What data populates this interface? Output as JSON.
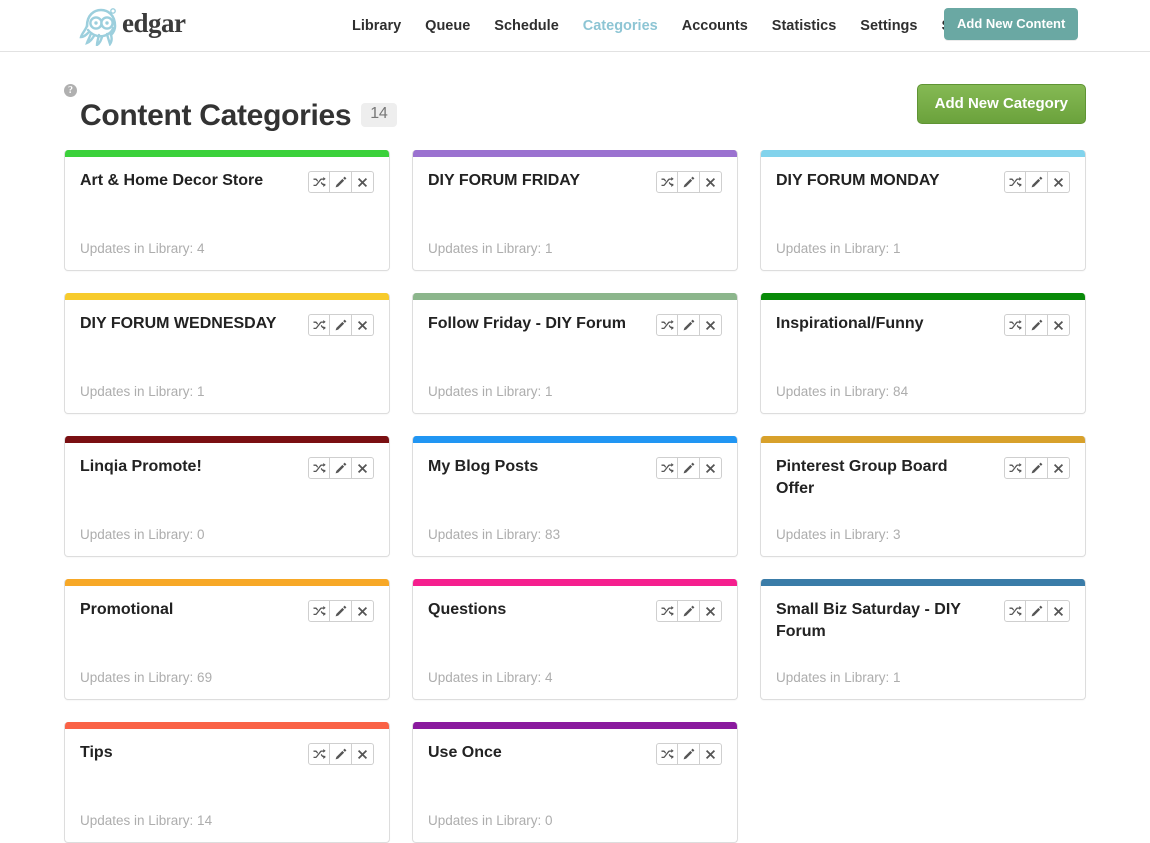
{
  "header": {
    "logo_word": "edgar",
    "logo_icon": "octopus-logo-icon",
    "nav": [
      {
        "label": "Library",
        "active": false
      },
      {
        "label": "Queue",
        "active": false
      },
      {
        "label": "Schedule",
        "active": false
      },
      {
        "label": "Categories",
        "active": true
      },
      {
        "label": "Accounts",
        "active": false
      },
      {
        "label": "Statistics",
        "active": false
      },
      {
        "label": "Settings",
        "active": false
      },
      {
        "label": "Sign Out",
        "active": false
      }
    ],
    "add_content_label": "Add New Content",
    "add_content_color": "#6aa8a3"
  },
  "page": {
    "help_icon": "?",
    "title": "Content Categories",
    "count": "14",
    "add_category_label": "Add New Category",
    "add_category_color": "#76ac46"
  },
  "card_actions": {
    "shuffle_title": "Shuffle",
    "edit_title": "Edit",
    "delete_title": "Delete"
  },
  "categories": [
    {
      "name": "Art & Home Decor Store",
      "meta": "Updates in Library: 4",
      "color": "#3bd13b"
    },
    {
      "name": "DIY FORUM FRIDAY",
      "meta": "Updates in Library: 1",
      "color": "#9b72d0"
    },
    {
      "name": "DIY FORUM MONDAY",
      "meta": "Updates in Library: 1",
      "color": "#82d3ec"
    },
    {
      "name": "DIY FORUM WEDNESDAY",
      "meta": "Updates in Library: 1",
      "color": "#f7cb2c"
    },
    {
      "name": "Follow Friday - DIY Forum",
      "meta": "Updates in Library: 1",
      "color": "#8cb68c"
    },
    {
      "name": "Inspirational/Funny",
      "meta": "Updates in Library: 84",
      "color": "#088a08"
    },
    {
      "name": "Linqia Promote!",
      "meta": "Updates in Library: 0",
      "color": "#7a0f12"
    },
    {
      "name": "My Blog Posts",
      "meta": "Updates in Library: 83",
      "color": "#2196f3"
    },
    {
      "name": "Pinterest Group Board Offer",
      "meta": "Updates in Library: 3",
      "color": "#d8a12b"
    },
    {
      "name": "Promotional",
      "meta": "Updates in Library: 69",
      "color": "#f7a827"
    },
    {
      "name": "Questions",
      "meta": "Updates in Library: 4",
      "color": "#f51f8e"
    },
    {
      "name": "Small Biz Saturday - DIY Forum",
      "meta": "Updates in Library: 1",
      "color": "#3a7ca8"
    },
    {
      "name": "Tips",
      "meta": "Updates in Library: 14",
      "color": "#fa6246"
    },
    {
      "name": "Use Once",
      "meta": "Updates in Library: 0",
      "color": "#8a1a9e"
    }
  ]
}
